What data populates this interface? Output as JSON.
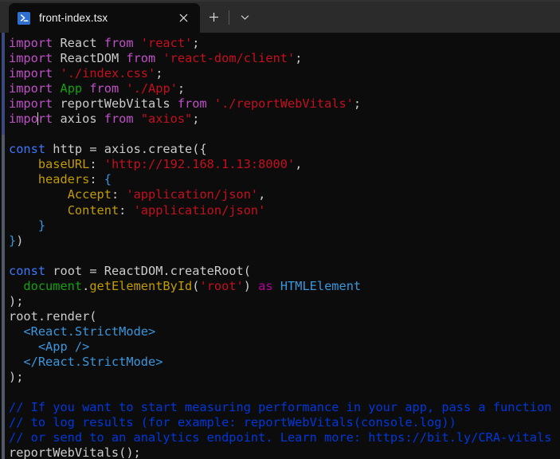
{
  "window": {
    "tab": {
      "icon": "powershell-icon",
      "title": "front-index.tsx",
      "close_label": "✕"
    },
    "new_tab_label": "+",
    "dropdown_label": "⌄"
  },
  "colors": {
    "titlebar_bg": "#2b2b2b",
    "terminal_bg": "#0c0c0c",
    "keyword_magenta": "#c050c8",
    "keyword_blue": "#3b78ff",
    "string_red": "#c50f1f",
    "identifier_green": "#13a10e",
    "property_yellow": "#c19c00",
    "jsx_cyan": "#3a96dd",
    "as_pink": "#b4009e",
    "comment_blue": "#0037da",
    "plain_text": "#cccccc",
    "tab_icon_blue": "#2f6fd0"
  },
  "editor": {
    "lines": [
      {
        "n": 1,
        "tokens": [
          {
            "t": "import",
            "c": "kw"
          },
          {
            "t": " React ",
            "c": "plain"
          },
          {
            "t": "from",
            "c": "kw"
          },
          {
            "t": " ",
            "c": "plain"
          },
          {
            "t": "'react'",
            "c": "str"
          },
          {
            "t": ";",
            "c": "plain"
          }
        ]
      },
      {
        "n": 2,
        "tokens": [
          {
            "t": "import",
            "c": "kw"
          },
          {
            "t": " ReactDOM ",
            "c": "plain"
          },
          {
            "t": "from",
            "c": "kw"
          },
          {
            "t": " ",
            "c": "plain"
          },
          {
            "t": "'react-dom/client'",
            "c": "str"
          },
          {
            "t": ";",
            "c": "plain"
          }
        ]
      },
      {
        "n": 3,
        "tokens": [
          {
            "t": "import",
            "c": "kw"
          },
          {
            "t": " ",
            "c": "plain"
          },
          {
            "t": "'./index.css'",
            "c": "str"
          },
          {
            "t": ";",
            "c": "plain"
          }
        ]
      },
      {
        "n": 4,
        "tokens": [
          {
            "t": "import",
            "c": "kw"
          },
          {
            "t": " ",
            "c": "plain"
          },
          {
            "t": "App",
            "c": "green"
          },
          {
            "t": " ",
            "c": "plain"
          },
          {
            "t": "from",
            "c": "kw"
          },
          {
            "t": " ",
            "c": "plain"
          },
          {
            "t": "'./App'",
            "c": "str"
          },
          {
            "t": ";",
            "c": "plain"
          }
        ]
      },
      {
        "n": 5,
        "tokens": [
          {
            "t": "import",
            "c": "kw"
          },
          {
            "t": " reportWebVitals ",
            "c": "plain"
          },
          {
            "t": "from",
            "c": "kw"
          },
          {
            "t": " ",
            "c": "plain"
          },
          {
            "t": "'./reportWebVitals'",
            "c": "str"
          },
          {
            "t": ";",
            "c": "plain"
          }
        ]
      },
      {
        "n": 6,
        "tokens": [
          {
            "t": "impo",
            "c": "kw"
          },
          {
            "t": "",
            "c": "cursor"
          },
          {
            "t": "rt",
            "c": "kw"
          },
          {
            "t": " axios ",
            "c": "plain"
          },
          {
            "t": "from",
            "c": "kw"
          },
          {
            "t": " ",
            "c": "plain"
          },
          {
            "t": "\"axios\"",
            "c": "str"
          },
          {
            "t": ";",
            "c": "plain"
          }
        ]
      },
      {
        "n": 7,
        "tokens": []
      },
      {
        "n": 8,
        "tokens": [
          {
            "t": "const",
            "c": "blue"
          },
          {
            "t": " http = axios.create({",
            "c": "plain"
          }
        ]
      },
      {
        "n": 9,
        "tokens": [
          {
            "t": "    ",
            "c": "plain"
          },
          {
            "t": "baseURL",
            "c": "prop"
          },
          {
            "t": ": ",
            "c": "plain"
          },
          {
            "t": "'http://192.168.1.13:8000'",
            "c": "str"
          },
          {
            "t": ",",
            "c": "plain"
          }
        ]
      },
      {
        "n": 10,
        "tokens": [
          {
            "t": "    ",
            "c": "plain"
          },
          {
            "t": "headers",
            "c": "prop"
          },
          {
            "t": ": ",
            "c": "plain"
          },
          {
            "t": "{",
            "c": "punct"
          }
        ]
      },
      {
        "n": 11,
        "tokens": [
          {
            "t": "        ",
            "c": "plain"
          },
          {
            "t": "Accept",
            "c": "prop"
          },
          {
            "t": ": ",
            "c": "plain"
          },
          {
            "t": "'application/json'",
            "c": "str"
          },
          {
            "t": ",",
            "c": "plain"
          }
        ]
      },
      {
        "n": 12,
        "tokens": [
          {
            "t": "        ",
            "c": "plain"
          },
          {
            "t": "Content",
            "c": "prop"
          },
          {
            "t": ": ",
            "c": "plain"
          },
          {
            "t": "'application/json'",
            "c": "str"
          }
        ]
      },
      {
        "n": 13,
        "tokens": [
          {
            "t": "    ",
            "c": "plain"
          },
          {
            "t": "}",
            "c": "punct"
          }
        ]
      },
      {
        "n": 14,
        "tokens": [
          {
            "t": "}",
            "c": "punct"
          },
          {
            "t": ")",
            "c": "plain"
          }
        ]
      },
      {
        "n": 15,
        "tokens": []
      },
      {
        "n": 16,
        "tokens": [
          {
            "t": "const",
            "c": "blue"
          },
          {
            "t": " root = ReactDOM.createRoot(",
            "c": "plain"
          }
        ]
      },
      {
        "n": 17,
        "tokens": [
          {
            "t": "  ",
            "c": "plain"
          },
          {
            "t": "document",
            "c": "green"
          },
          {
            "t": ".",
            "c": "plain"
          },
          {
            "t": "getElementById",
            "c": "prop"
          },
          {
            "t": "(",
            "c": "plain"
          },
          {
            "t": "'root'",
            "c": "str"
          },
          {
            "t": ") ",
            "c": "plain"
          },
          {
            "t": "as",
            "c": "pink"
          },
          {
            "t": " ",
            "c": "plain"
          },
          {
            "t": "HTMLElement",
            "c": "cyan"
          }
        ]
      },
      {
        "n": 18,
        "tokens": [
          {
            "t": ");",
            "c": "plain"
          }
        ]
      },
      {
        "n": 19,
        "tokens": [
          {
            "t": "root.render(",
            "c": "plain"
          }
        ]
      },
      {
        "n": 20,
        "tokens": [
          {
            "t": "  ",
            "c": "plain"
          },
          {
            "t": "<React.StrictMode>",
            "c": "cyan"
          }
        ]
      },
      {
        "n": 21,
        "tokens": [
          {
            "t": "    ",
            "c": "plain"
          },
          {
            "t": "<App />",
            "c": "cyan"
          }
        ]
      },
      {
        "n": 22,
        "tokens": [
          {
            "t": "  ",
            "c": "plain"
          },
          {
            "t": "</React.StrictMode>",
            "c": "cyan"
          }
        ]
      },
      {
        "n": 23,
        "tokens": [
          {
            "t": ");",
            "c": "plain"
          }
        ]
      },
      {
        "n": 24,
        "tokens": []
      },
      {
        "n": 25,
        "tokens": [
          {
            "t": "// If you want to start measuring performance in your app, pass a function",
            "c": "cmt"
          }
        ]
      },
      {
        "n": 26,
        "tokens": [
          {
            "t": "// to log results (for example: reportWebVitals(console.log))",
            "c": "cmt"
          }
        ]
      },
      {
        "n": 27,
        "tokens": [
          {
            "t": "// or send to an analytics endpoint. Learn more: https://bit.ly/CRA-vitals",
            "c": "cmt"
          }
        ]
      },
      {
        "n": 28,
        "tokens": [
          {
            "t": "reportWebVitals();",
            "c": "plain"
          }
        ]
      }
    ]
  }
}
